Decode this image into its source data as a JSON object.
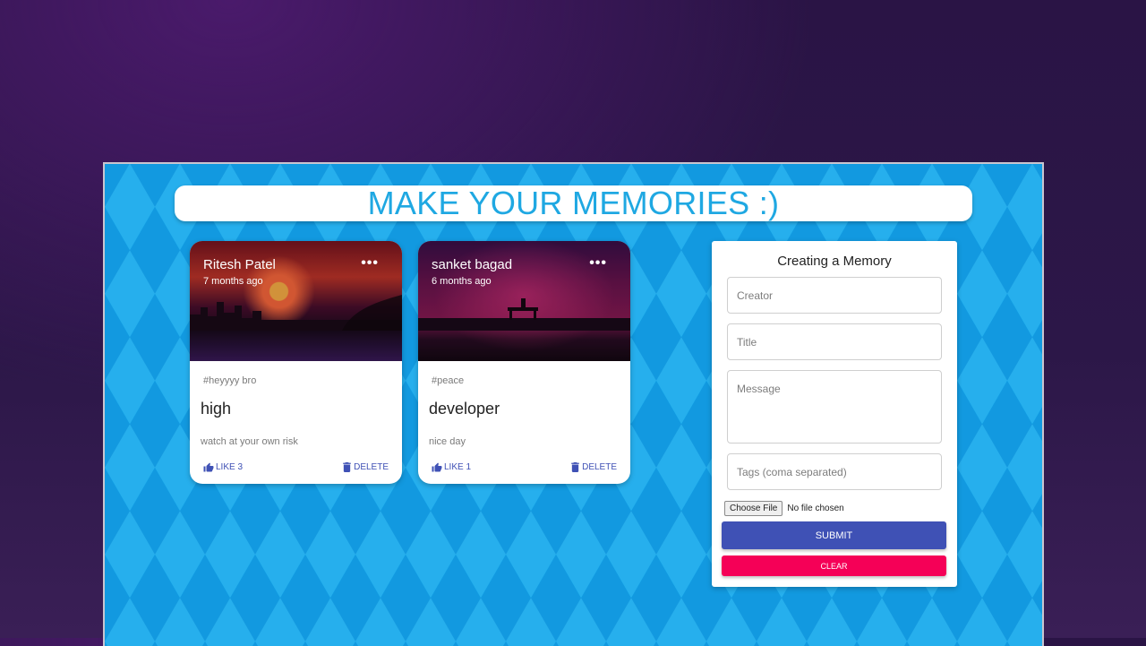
{
  "header": {
    "title": "MAKE YOUR MEMORIES :)"
  },
  "posts": [
    {
      "creator": "Ritesh Patel",
      "time": "7 months ago",
      "tags": "#heyyyy bro",
      "title": "high",
      "message": "watch at your own risk",
      "like_label": "LIKE 3",
      "delete_label": "DELETE",
      "more_icon": "more-horizontal-icon"
    },
    {
      "creator": "sanket bagad",
      "time": "6 months ago",
      "tags": "#peace",
      "title": "developer",
      "message": "nice day",
      "like_label": "LIKE 1",
      "delete_label": "DELETE",
      "more_icon": "more-horizontal-icon"
    }
  ],
  "form": {
    "heading": "Creating a Memory",
    "creator_placeholder": "Creator",
    "title_placeholder": "Title",
    "message_placeholder": "Message",
    "tags_placeholder": "Tags (coma separated)",
    "file_button": "Choose File",
    "file_status": "No file chosen",
    "submit_label": "SUBMIT",
    "clear_label": "CLEAR"
  },
  "colors": {
    "accent": "#3f51b5",
    "secondary": "#f50057",
    "title_color": "#1fa8e2",
    "background": "#15a9ec"
  }
}
